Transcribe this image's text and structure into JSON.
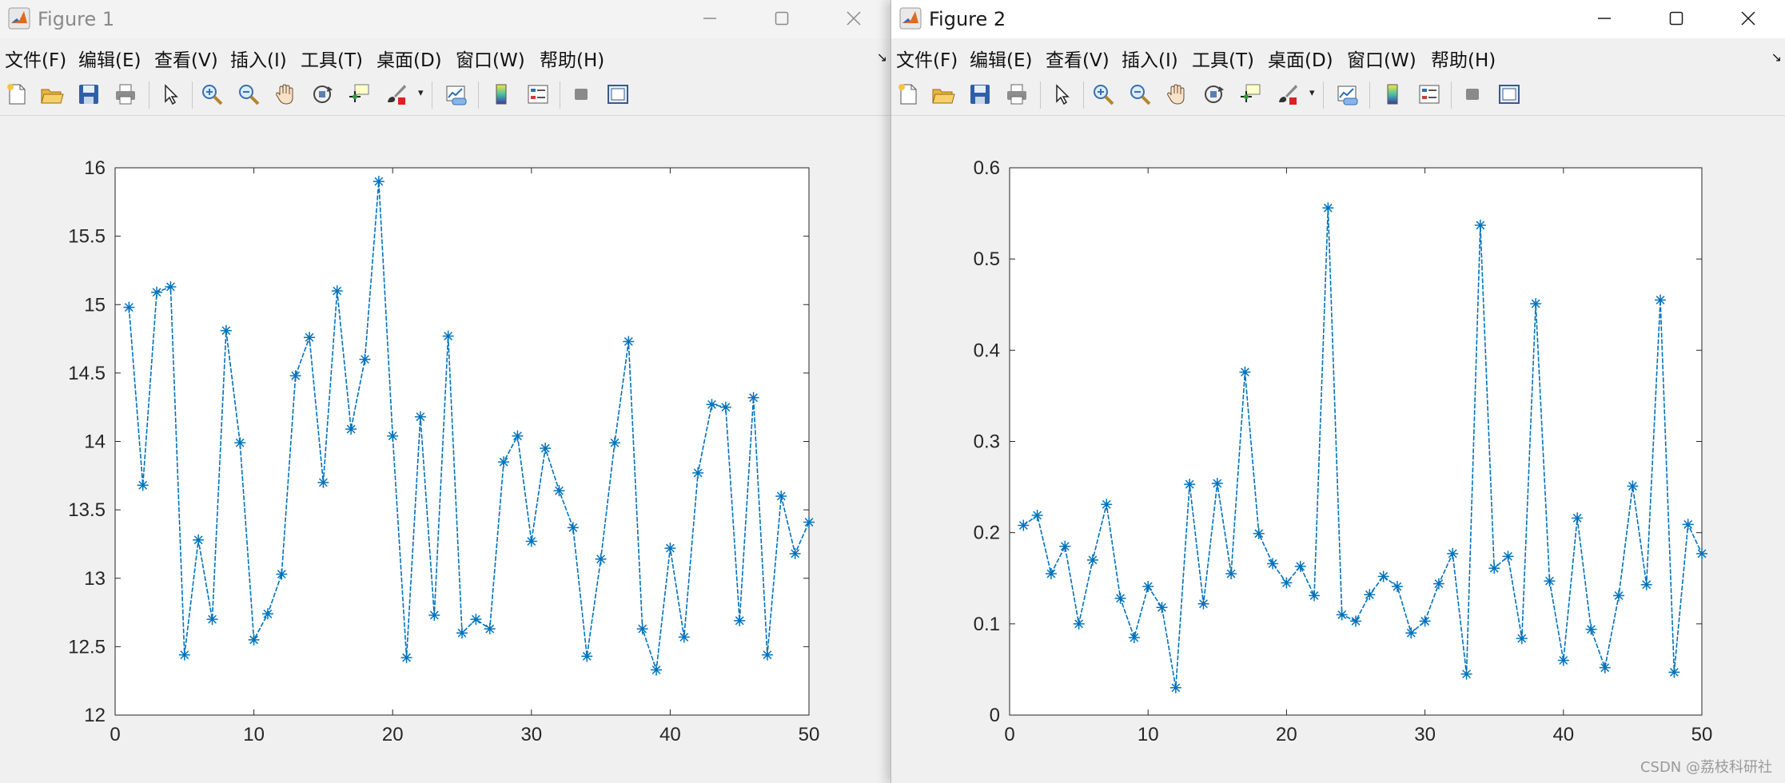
{
  "windows": [
    {
      "title": "Figure 1",
      "menu": [
        "文件(F)",
        "编辑(E)",
        "查看(V)",
        "插入(I)",
        "工具(T)",
        "桌面(D)",
        "窗口(W)",
        "帮助(H)"
      ],
      "menu_overflow": "↘"
    },
    {
      "title": "Figure 2",
      "menu": [
        "文件(F)",
        "编辑(E)",
        "查看(V)",
        "插入(I)",
        "工具(T)",
        "桌面(D)",
        "窗口(W)",
        "帮助(H)"
      ],
      "menu_overflow": "↘"
    }
  ],
  "toolbar_icons": [
    "new-figure-icon",
    "open-file-icon",
    "save-icon",
    "print-icon",
    "pointer-icon",
    "zoom-in-icon",
    "zoom-out-icon",
    "pan-hand-icon",
    "rotate-3d-icon",
    "data-cursor-icon",
    "brush-icon",
    "link-plot-icon",
    "colorbar-icon",
    "legend-icon",
    "hide-plot-tools-icon",
    "show-plot-tools-icon"
  ],
  "watermark": "CSDN @荔枝科研社",
  "colors": {
    "series": "#0072bd",
    "axes": "#262626",
    "plot_bg": "#ffffff"
  },
  "chart_data": [
    {
      "type": "line",
      "marker": "asterisk",
      "title": "",
      "xlabel": "",
      "ylabel": "",
      "xlim": [
        0,
        50
      ],
      "ylim": [
        12,
        16
      ],
      "xticks": [
        "0",
        "10",
        "20",
        "30",
        "40",
        "50"
      ],
      "yticks": [
        "12",
        "12.5",
        "13",
        "13.5",
        "14",
        "14.5",
        "15",
        "15.5",
        "16"
      ],
      "grid": false,
      "x": [
        1,
        2,
        3,
        4,
        5,
        6,
        7,
        8,
        9,
        10,
        11,
        12,
        13,
        14,
        15,
        16,
        17,
        18,
        19,
        20,
        21,
        22,
        23,
        24,
        25,
        26,
        27,
        28,
        29,
        30,
        31,
        32,
        33,
        34,
        35,
        36,
        37,
        38,
        39,
        40,
        41,
        42,
        43,
        44,
        45,
        46,
        47,
        48,
        49,
        50
      ],
      "series": [
        {
          "values": [
            14.98,
            13.68,
            15.09,
            15.13,
            12.44,
            13.28,
            12.7,
            14.81,
            13.99,
            12.55,
            12.74,
            13.03,
            14.48,
            14.76,
            13.7,
            15.1,
            14.09,
            14.6,
            15.9,
            14.04,
            12.42,
            14.18,
            12.73,
            14.77,
            12.6,
            12.7,
            12.63,
            13.85,
            14.04,
            13.27,
            13.95,
            13.64,
            13.37,
            12.43,
            13.14,
            13.99,
            14.73,
            12.63,
            12.33,
            13.22,
            12.57,
            13.77,
            14.27,
            14.25,
            12.69,
            14.32,
            12.44,
            13.6,
            13.18,
            13.41
          ]
        }
      ]
    },
    {
      "type": "line",
      "marker": "asterisk",
      "title": "",
      "xlabel": "",
      "ylabel": "",
      "xlim": [
        0,
        50
      ],
      "ylim": [
        0,
        0.6
      ],
      "xticks": [
        "0",
        "10",
        "20",
        "30",
        "40",
        "50"
      ],
      "yticks": [
        "0",
        "0.1",
        "0.2",
        "0.3",
        "0.4",
        "0.5",
        "0.6"
      ],
      "grid": false,
      "x": [
        1,
        2,
        3,
        4,
        5,
        6,
        7,
        8,
        9,
        10,
        11,
        12,
        13,
        14,
        15,
        16,
        17,
        18,
        19,
        20,
        21,
        22,
        23,
        24,
        25,
        26,
        27,
        28,
        29,
        30,
        31,
        32,
        33,
        34,
        35,
        36,
        37,
        38,
        39,
        40,
        41,
        42,
        43,
        44,
        45,
        46,
        47,
        48,
        49,
        50
      ],
      "series": [
        {
          "values": [
            0.208,
            0.219,
            0.155,
            0.185,
            0.1,
            0.17,
            0.231,
            0.128,
            0.085,
            0.141,
            0.118,
            0.03,
            0.253,
            0.122,
            0.254,
            0.155,
            0.376,
            0.199,
            0.166,
            0.145,
            0.163,
            0.131,
            0.556,
            0.11,
            0.103,
            0.132,
            0.152,
            0.141,
            0.09,
            0.103,
            0.144,
            0.177,
            0.045,
            0.537,
            0.161,
            0.174,
            0.084,
            0.451,
            0.147,
            0.06,
            0.216,
            0.094,
            0.052,
            0.131,
            0.251,
            0.143,
            0.455,
            0.047,
            0.209,
            0.177
          ]
        }
      ]
    }
  ]
}
